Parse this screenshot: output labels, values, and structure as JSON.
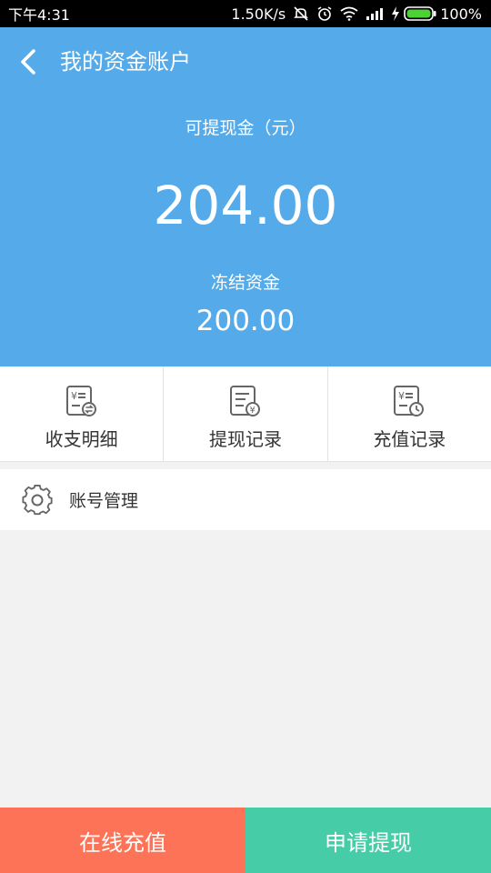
{
  "status_bar": {
    "time": "下午4:31",
    "speed": "1.50K/s",
    "battery": "100%"
  },
  "header": {
    "title": "我的资金账户"
  },
  "balance": {
    "available_label": "可提现金（元）",
    "available_amount": "204.00",
    "frozen_label": "冻结资金",
    "frozen_amount": "200.00"
  },
  "shortcuts": [
    {
      "label": "收支明细",
      "icon": "income-expense-detail-icon"
    },
    {
      "label": "提现记录",
      "icon": "withdraw-record-icon"
    },
    {
      "label": "充值记录",
      "icon": "recharge-record-icon"
    }
  ],
  "account_management": {
    "label": "账号管理",
    "icon": "gear-icon"
  },
  "bottom_buttons": {
    "recharge": "在线充值",
    "withdraw": "申请提现"
  },
  "colors": {
    "header_blue": "#55aaea",
    "recharge_orange": "#fd7357",
    "withdraw_green": "#46cca6"
  }
}
